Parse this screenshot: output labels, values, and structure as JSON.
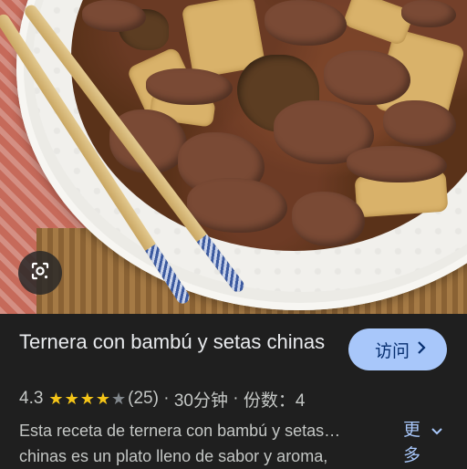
{
  "result": {
    "title": "Ternera con bambú y setas chinas",
    "visit_label": "访问",
    "rating": "4.3",
    "rating_stars": 4.3,
    "review_count": "(25)",
    "time": "30分钟",
    "servings": "份数：4",
    "separator": " · ",
    "description_line1": "Esta receta de ternera con bambú y setas…",
    "description_line2": "chinas es un plato lleno de sabor y aroma,",
    "more_label_1": "更",
    "more_label_2": "多"
  },
  "icons": {
    "lens": "google-lens-icon",
    "chevron_right": "chevron-right-icon",
    "chevron_down": "chevron-down-icon"
  },
  "colors": {
    "background": "#1f1f1f",
    "button": "#a8c7fa",
    "star": "#f5c518",
    "text": "#e8eaed"
  }
}
